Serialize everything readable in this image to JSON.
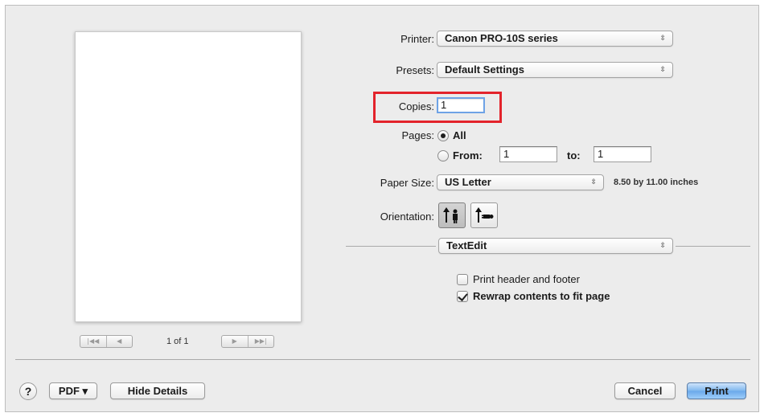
{
  "printer": {
    "label": "Printer:",
    "value": "Canon PRO-10S series",
    "arrows_icon": "up-down-arrows-icon"
  },
  "presets": {
    "label": "Presets:",
    "value": "Default Settings"
  },
  "copies": {
    "label": "Copies:",
    "value": "1"
  },
  "pages": {
    "label": "Pages:",
    "all_label": "All",
    "all_selected": true,
    "from_label": "From:",
    "from_value": "1",
    "to_label": "to:",
    "to_value": "1"
  },
  "paper_size": {
    "label": "Paper Size:",
    "value": "US Letter",
    "dimensions": "8.50 by 11.00 inches"
  },
  "orientation": {
    "label": "Orientation:",
    "selected": "portrait"
  },
  "section": {
    "value": "TextEdit"
  },
  "options": {
    "print_header_footer": {
      "label": "Print header and footer",
      "checked": false
    },
    "rewrap": {
      "label": "Rewrap contents to fit page",
      "checked": true
    }
  },
  "preview_nav": {
    "page_count": "1 of 1",
    "first": "|◀◀",
    "prev": "◀",
    "next": "▶",
    "last": "▶▶|"
  },
  "footer": {
    "help": "?",
    "pdf": "PDF ▾",
    "hide_details": "Hide Details",
    "cancel": "Cancel",
    "print": "Print"
  },
  "colors": {
    "highlight": "#e3232b",
    "primary_button": "#6aa8ea",
    "focus_ring": "#6ea3e6"
  }
}
